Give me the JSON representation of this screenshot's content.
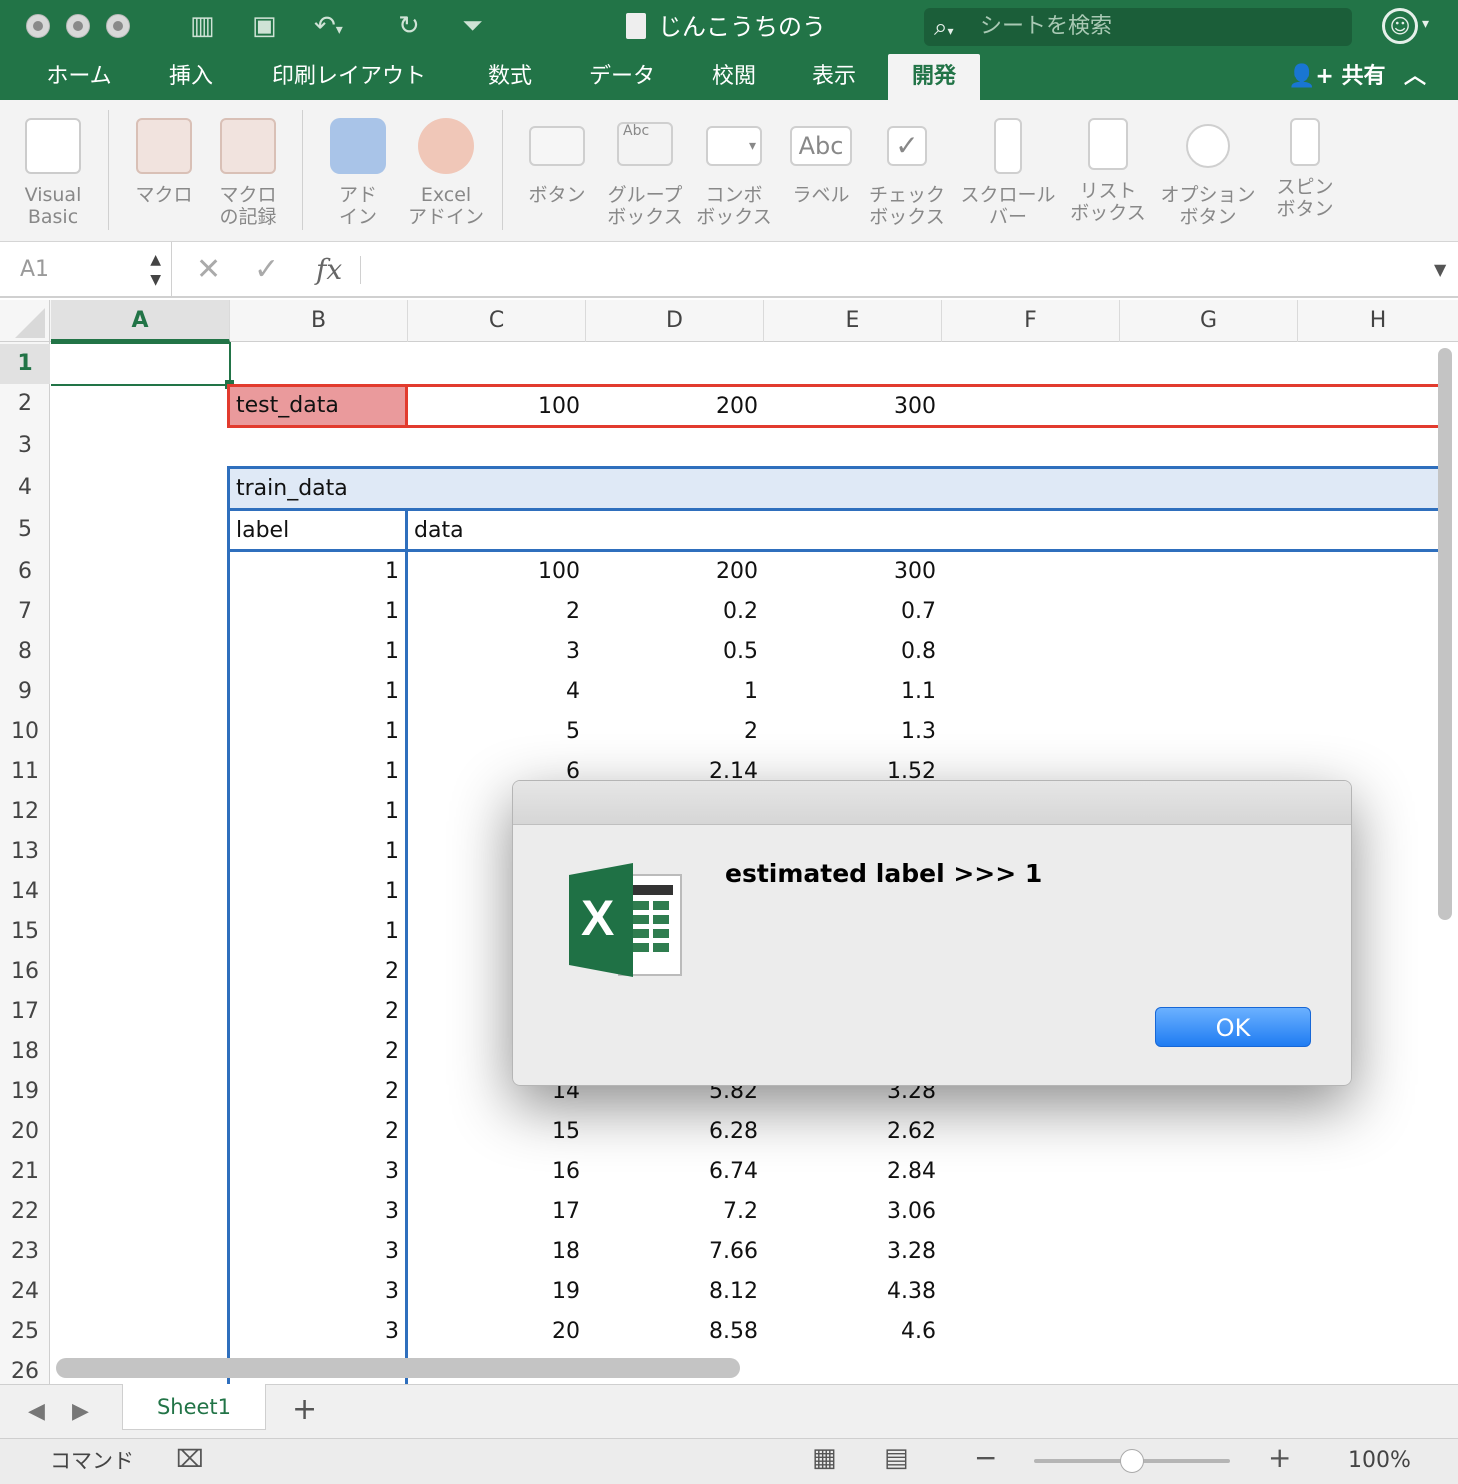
{
  "window": {
    "title": "じんこうちのう",
    "search_placeholder": "シートを検索"
  },
  "ribbon_tabs": [
    "ホーム",
    "挿入",
    "印刷レイアウト",
    "数式",
    "データ",
    "校閲",
    "表示",
    "開発"
  ],
  "active_tab": "開発",
  "share_label": "共有",
  "ribbon_buttons": {
    "visual_basic": [
      "Visual",
      "Basic"
    ],
    "macro": [
      "マクロ"
    ],
    "record_macro": [
      "マクロ",
      "の記録"
    ],
    "addin": [
      "アド",
      "イン"
    ],
    "excel_addin": [
      "Excel",
      "アドイン"
    ],
    "button": [
      "ボタン"
    ],
    "group_box": [
      "グループ",
      "ボックス"
    ],
    "combo_box": [
      "コンボ",
      "ボックス"
    ],
    "label": [
      "ラベル"
    ],
    "check_box": [
      "チェック",
      "ボックス"
    ],
    "scroll_bar": [
      "スクロール",
      "バー"
    ],
    "list_box": [
      "リスト",
      "ボックス"
    ],
    "option_button": [
      "オプション",
      "ボタン"
    ],
    "spin_button": [
      "スピン",
      "ボタン"
    ],
    "abc_glyph": "Abc"
  },
  "formula_bar": {
    "name_box": "A1",
    "formula": ""
  },
  "columns": [
    "A",
    "B",
    "C",
    "D",
    "E",
    "F",
    "G",
    "H"
  ],
  "rows": [
    "1",
    "2",
    "3",
    "4",
    "5",
    "6",
    "7",
    "8",
    "9",
    "10",
    "11",
    "12",
    "13",
    "14",
    "15",
    "16",
    "17",
    "18",
    "19",
    "20",
    "21",
    "22",
    "23",
    "24",
    "25",
    "26"
  ],
  "sheet": {
    "test_data": {
      "label": "test_data",
      "values": [
        "100",
        "200",
        "300"
      ]
    },
    "train_data": {
      "title": "train_data",
      "headers": [
        "label",
        "data"
      ],
      "rows": [
        [
          "1",
          "100",
          "200",
          "300"
        ],
        [
          "1",
          "2",
          "0.2",
          "0.7"
        ],
        [
          "1",
          "3",
          "0.5",
          "0.8"
        ],
        [
          "1",
          "4",
          "1",
          "1.1"
        ],
        [
          "1",
          "5",
          "2",
          "1.3"
        ],
        [
          "1",
          "6",
          "2.14",
          "1.52"
        ],
        [
          "1",
          "",
          "",
          ""
        ],
        [
          "1",
          "",
          "",
          ""
        ],
        [
          "1",
          "",
          "",
          ""
        ],
        [
          "1",
          "",
          "",
          ""
        ],
        [
          "2",
          "",
          "",
          ""
        ],
        [
          "2",
          "",
          "",
          ""
        ],
        [
          "2",
          "",
          "",
          ""
        ],
        [
          "2",
          "14",
          "5.82",
          "3.28"
        ],
        [
          "2",
          "15",
          "6.28",
          "2.62"
        ],
        [
          "3",
          "16",
          "6.74",
          "2.84"
        ],
        [
          "3",
          "17",
          "7.2",
          "3.06"
        ],
        [
          "3",
          "18",
          "7.66",
          "3.28"
        ],
        [
          "3",
          "19",
          "8.12",
          "4.38"
        ],
        [
          "3",
          "20",
          "8.58",
          "4.6"
        ]
      ]
    }
  },
  "dialog": {
    "message": "estimated label >>> 1",
    "ok_label": "OK"
  },
  "sheet_tabs": [
    "Sheet1"
  ],
  "status": {
    "mode": "コマンド",
    "zoom": "100%"
  },
  "colors": {
    "excel_green": "#227447",
    "test_border": "#e23b2e",
    "test_fill": "#ea9a9c",
    "train_border": "#2f6fbd",
    "train_fill": "#dfe9f6"
  }
}
